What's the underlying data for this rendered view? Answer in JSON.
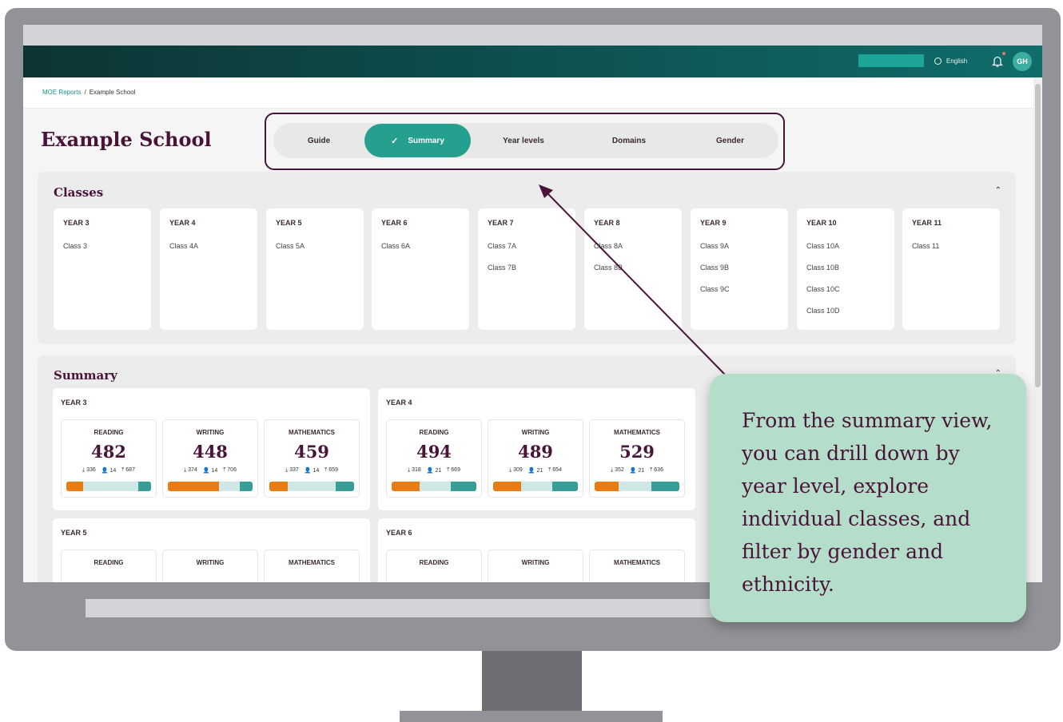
{
  "topbar": {
    "language": "English",
    "user_initials": "GH"
  },
  "breadcrumb": {
    "root": "MOE Reports",
    "separator": "/",
    "current": "Example School"
  },
  "school": {
    "title": "Example School"
  },
  "tabs": [
    {
      "label": "Guide"
    },
    {
      "label": "Summary",
      "active": true
    },
    {
      "label": "Year levels"
    },
    {
      "label": "Domains"
    },
    {
      "label": "Gender"
    }
  ],
  "classes": {
    "title": "Classes",
    "years": [
      {
        "year": "YEAR 3",
        "classes": [
          "Class 3"
        ]
      },
      {
        "year": "YEAR 4",
        "classes": [
          "Class 4A"
        ]
      },
      {
        "year": "YEAR 5",
        "classes": [
          "Class 5A"
        ]
      },
      {
        "year": "YEAR 6",
        "classes": [
          "Class 6A"
        ]
      },
      {
        "year": "YEAR 7",
        "classes": [
          "Class 7A",
          "Class 7B"
        ]
      },
      {
        "year": "YEAR 8",
        "classes": [
          "Class 8A",
          "Class 8B"
        ]
      },
      {
        "year": "YEAR 9",
        "classes": [
          "Class 9A",
          "Class 9B",
          "Class 9C"
        ]
      },
      {
        "year": "YEAR 10",
        "classes": [
          "Class 10A",
          "Class 10B",
          "Class 10C",
          "Class 10D"
        ]
      },
      {
        "year": "YEAR 11",
        "classes": [
          "Class 11"
        ]
      }
    ]
  },
  "summary": {
    "title": "Summary",
    "years": [
      {
        "year": "YEAR 3",
        "domains": [
          {
            "name": "READING",
            "value": "482",
            "low": "336",
            "count": "14",
            "high": "687",
            "low_share": 0.2,
            "high_share": 0.15
          },
          {
            "name": "WRITING",
            "value": "448",
            "low": "374",
            "count": "14",
            "high": "706",
            "low_share": 0.6,
            "high_share": 0.15
          },
          {
            "name": "MATHEMATICS",
            "value": "459",
            "low": "337",
            "count": "14",
            "high": "659",
            "low_share": 0.22,
            "high_share": 0.22
          }
        ]
      },
      {
        "year": "YEAR 4",
        "domains": [
          {
            "name": "READING",
            "value": "494",
            "low": "318",
            "count": "21",
            "high": "669",
            "low_share": 0.33,
            "high_share": 0.3
          },
          {
            "name": "WRITING",
            "value": "489",
            "low": "309",
            "count": "21",
            "high": "654",
            "low_share": 0.33,
            "high_share": 0.3
          },
          {
            "name": "MATHEMATICS",
            "value": "529",
            "low": "352",
            "count": "21",
            "high": "636",
            "low_share": 0.28,
            "high_share": 0.33
          }
        ]
      },
      {
        "year": "YEAR 5",
        "domains": [
          {
            "name": "READING"
          },
          {
            "name": "WRITING"
          },
          {
            "name": "MATHEMATICS"
          }
        ]
      },
      {
        "year": "YEAR 6",
        "domains": [
          {
            "name": "READING"
          },
          {
            "name": "WRITING"
          },
          {
            "name": "MATHEMATICS"
          }
        ]
      }
    ]
  },
  "callout": {
    "text": "From the summary view, you can drill down by year level, explore individual classes, and filter by gender and ethnicity."
  },
  "colors": {
    "brand": "#4a1438",
    "accent": "#25a08f",
    "low": "#e87b14",
    "high": "#3a9e98",
    "callout_bg": "#b4ddca"
  }
}
